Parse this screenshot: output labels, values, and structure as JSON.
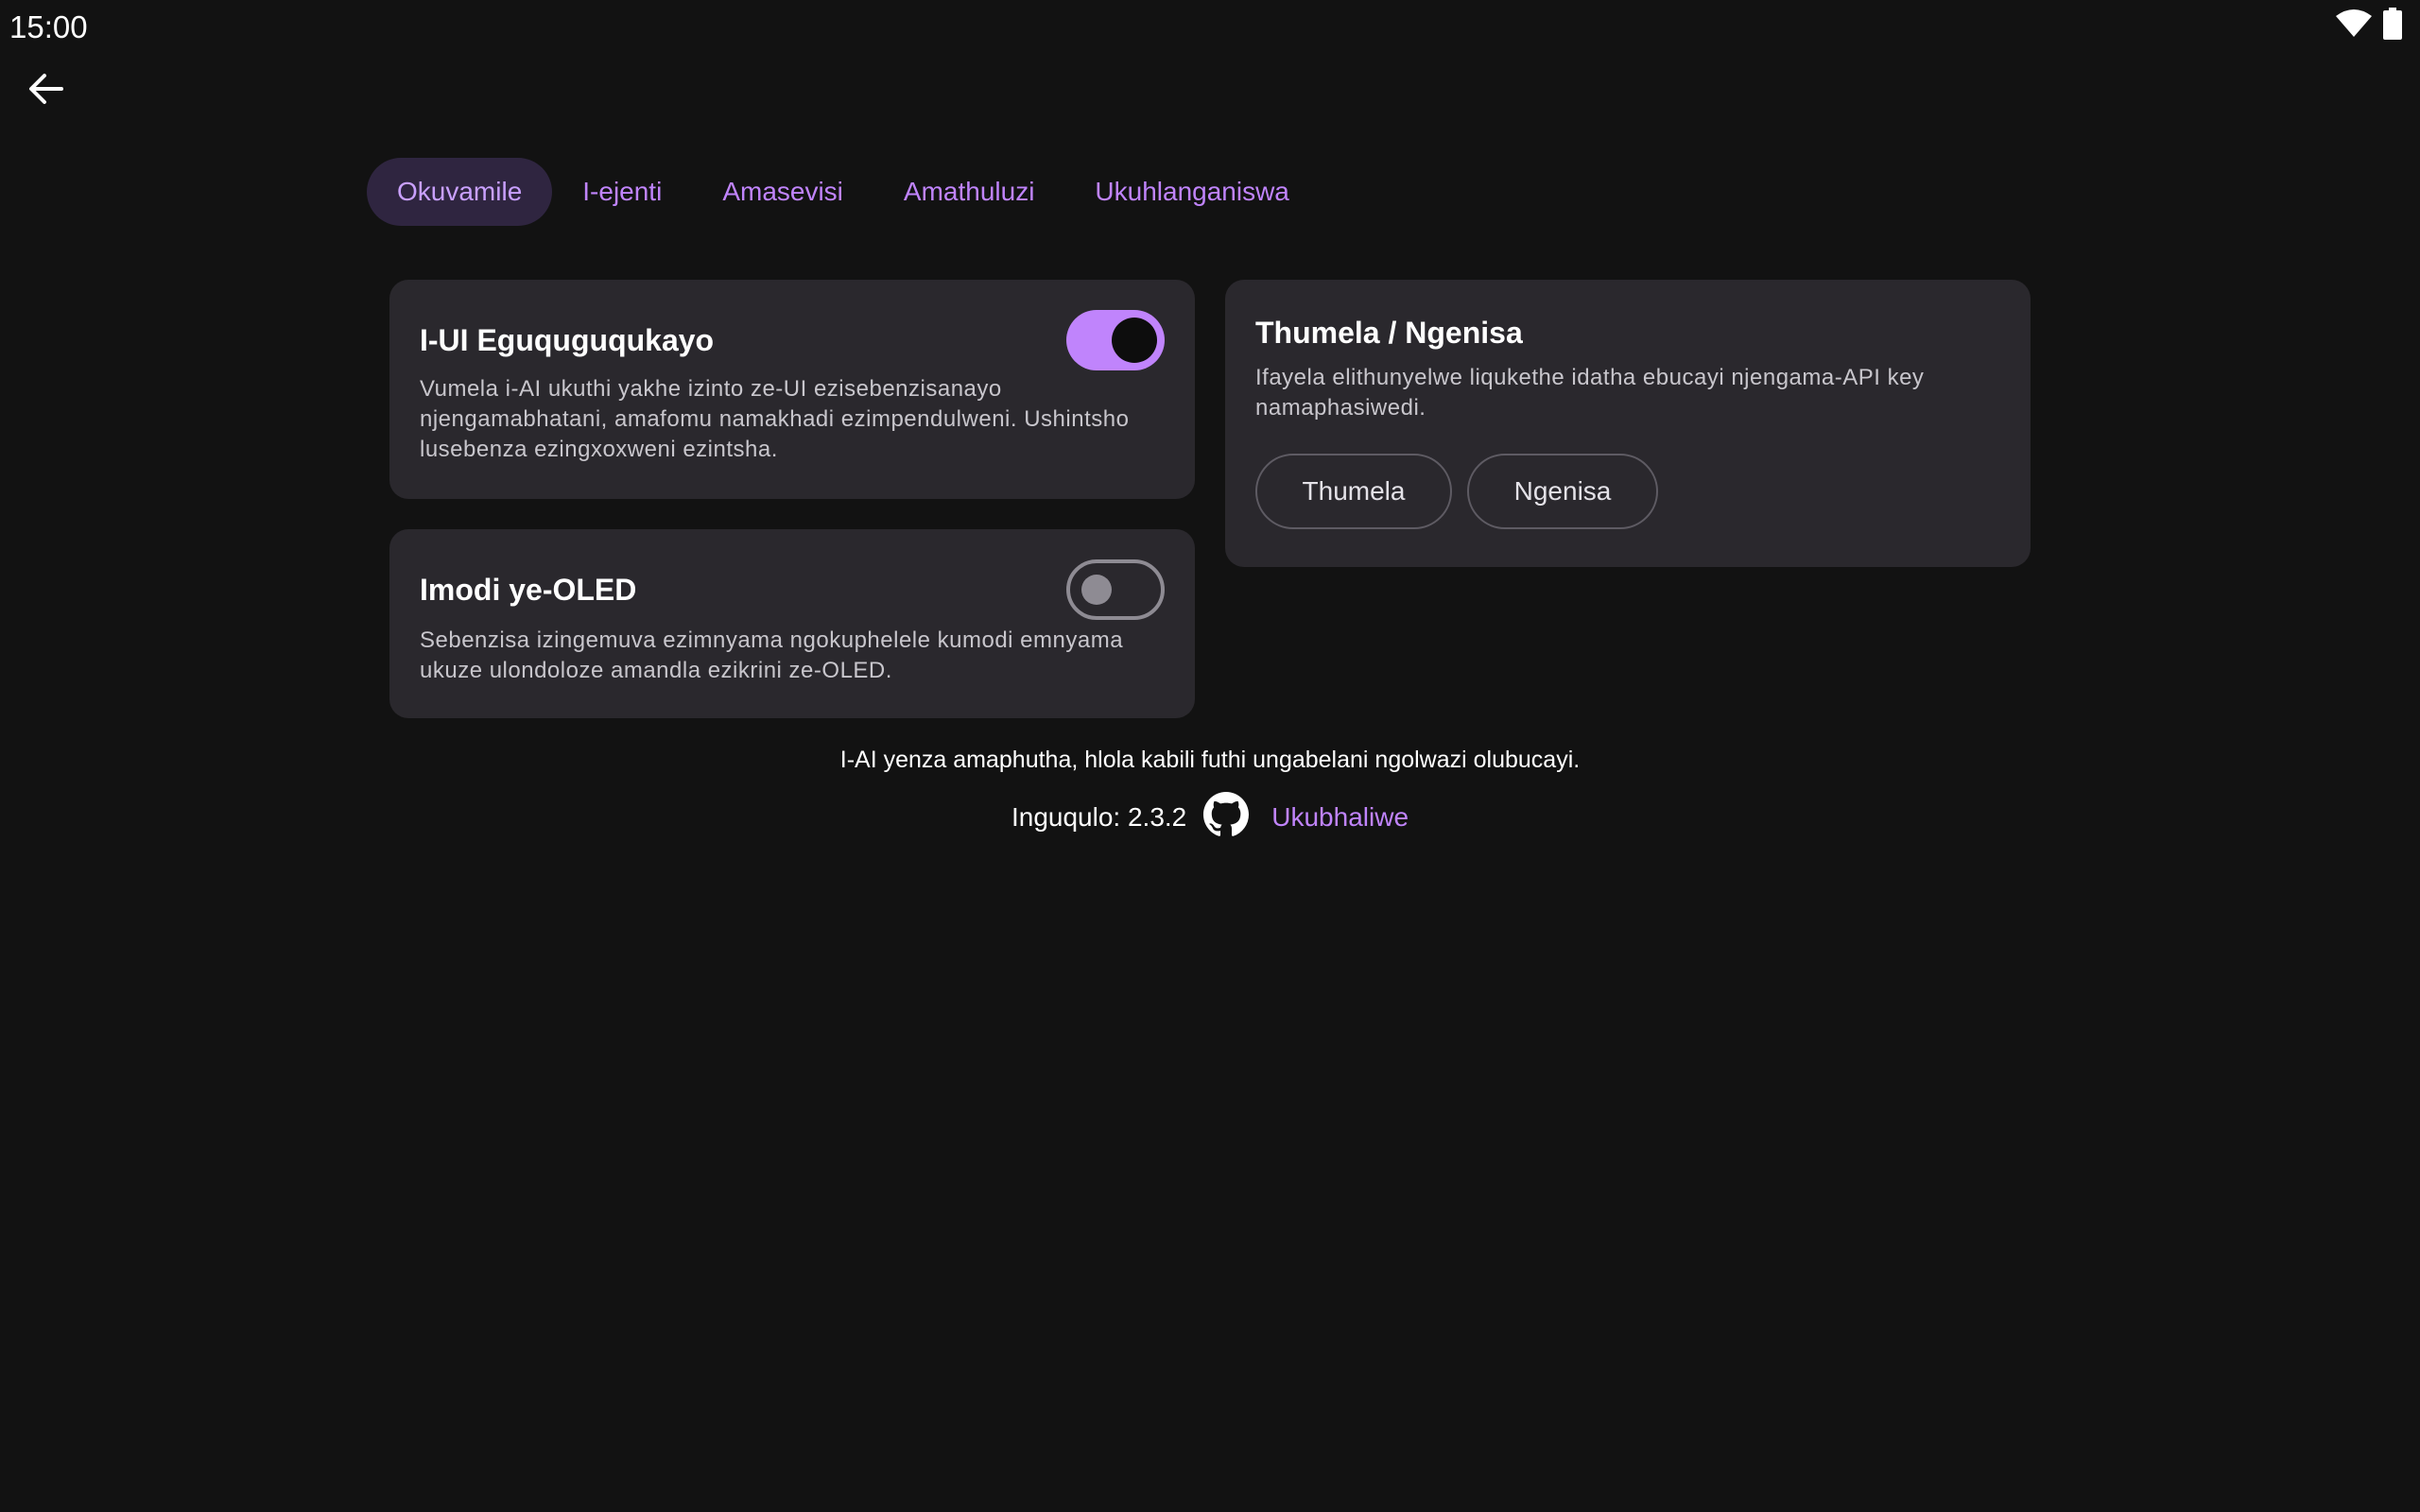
{
  "status_bar": {
    "time": "15:00",
    "icons": [
      "wifi-icon",
      "battery-icon"
    ]
  },
  "nav": {
    "back_icon": "arrow-left-icon"
  },
  "tabs": [
    {
      "label": "Okuvamile",
      "active": true
    },
    {
      "label": "I-ejenti",
      "active": false
    },
    {
      "label": "Amasevisi",
      "active": false
    },
    {
      "label": "Amathuluzi",
      "active": false
    },
    {
      "label": "Ukuhlanganiswa",
      "active": false
    }
  ],
  "settings": {
    "adaptive_ui": {
      "title": "I-UI Eguquguqukayo",
      "description": "Vumela i-AI ukuthi yakhe izinto ze-UI ezisebenzisanayo njengamabhatani, amafomu namakhadi ezimpendulweni. Ushintsho lusebenza ezingxoxweni ezintsha.",
      "enabled": true
    },
    "oled_mode": {
      "title": "Imodi ye-OLED",
      "description": "Sebenzisa izingemuva ezimnyama ngokuphelele kumodi emnyama ukuze ulondoloze amandla ezikrini ze-OLED.",
      "enabled": false
    },
    "export_import": {
      "title": "Thumela / Ngenisa",
      "description": "Ifayela elithunyelwe liqukethe idatha ebucayi njengama-API key namaphasiwedi.",
      "export_label": "Thumela",
      "import_label": "Ngenisa"
    }
  },
  "footer": {
    "disclaimer": "I-AI yenza amaphutha, hlola kabili futhi ungabelani ngolwazi olubucayi.",
    "version": "Inguqulo: 2.3.2",
    "source_icon": "github-icon",
    "source_label": "Ukubhaliwe"
  },
  "colors": {
    "background": "#121212",
    "card": "#2a282d",
    "accent": "#c084fc",
    "active_tab_bg": "#2f2540"
  }
}
